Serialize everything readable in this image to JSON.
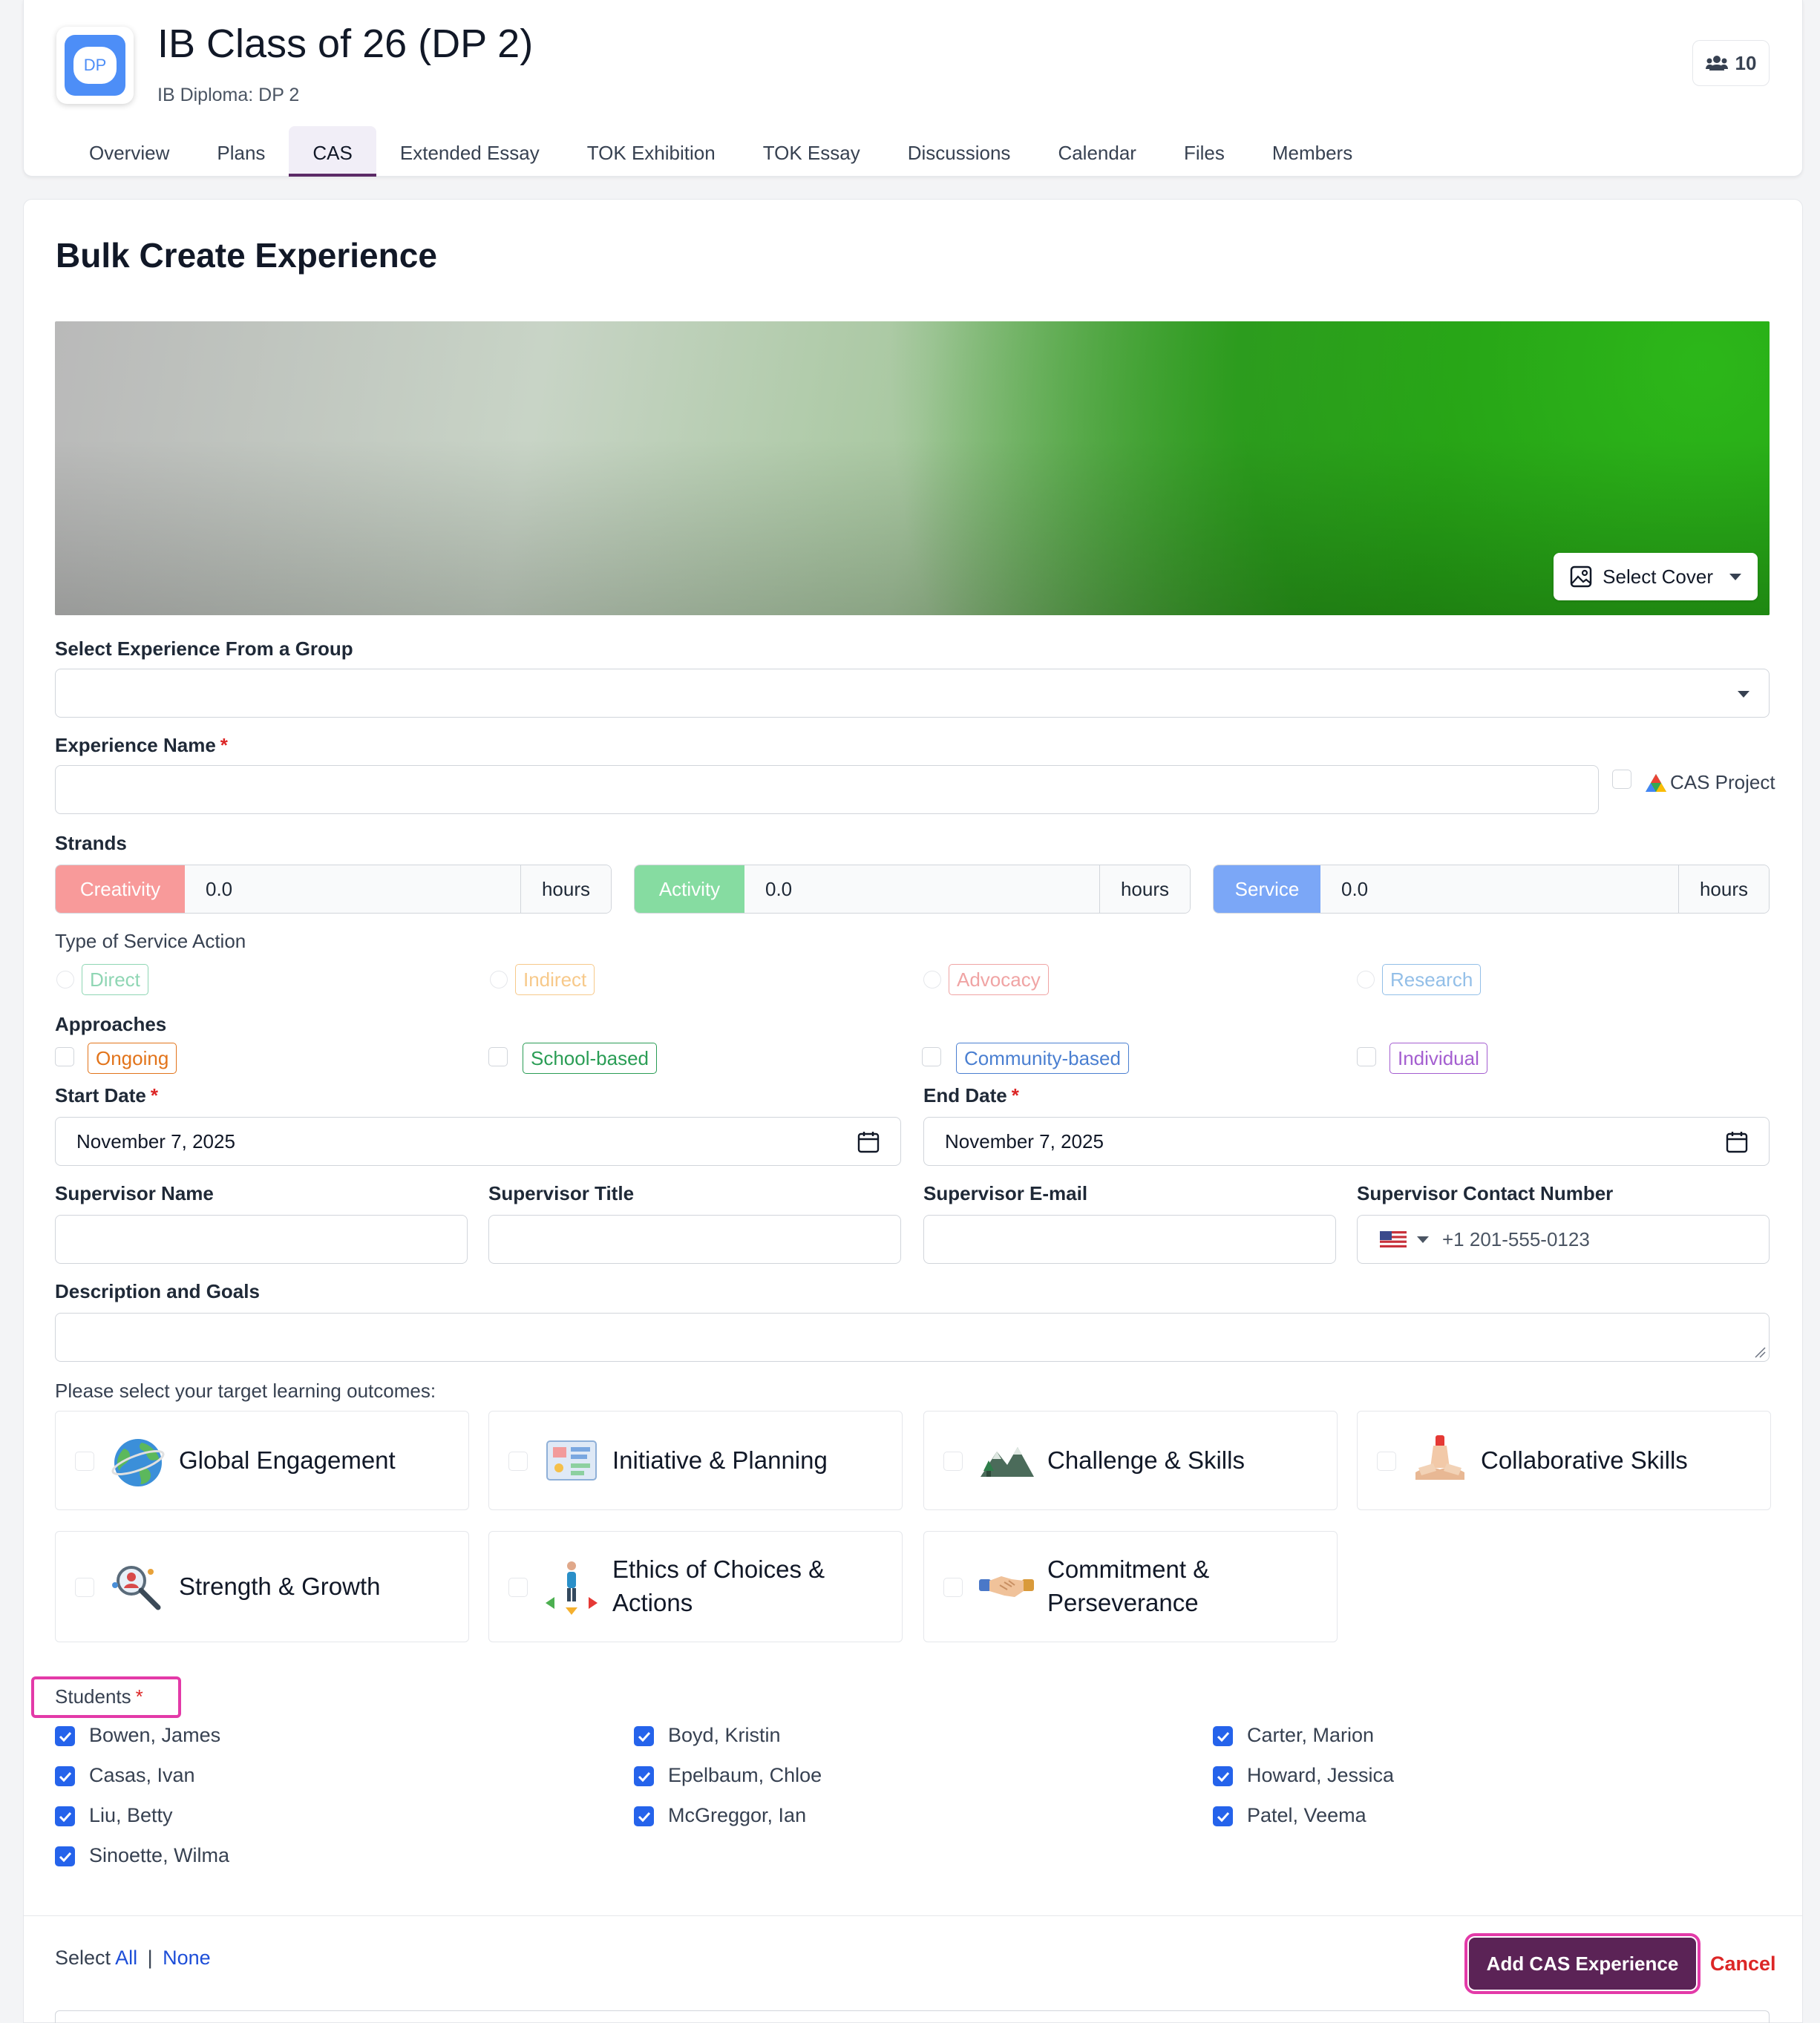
{
  "header": {
    "logo_text": "DP",
    "title": "IB Class of 26 (DP 2)",
    "subtitle": "IB Diploma: DP 2",
    "member_count": "10",
    "tabs": [
      {
        "label": "Overview"
      },
      {
        "label": "Plans"
      },
      {
        "label": "CAS",
        "active": true
      },
      {
        "label": "Extended Essay"
      },
      {
        "label": "TOK Exhibition"
      },
      {
        "label": "TOK Essay"
      },
      {
        "label": "Discussions"
      },
      {
        "label": "Calendar"
      },
      {
        "label": "Files"
      },
      {
        "label": "Members"
      }
    ]
  },
  "form": {
    "heading": "Bulk Create Experience",
    "select_cover_label": "Select Cover",
    "group_label": "Select Experience From a Group",
    "group_value": "",
    "name_label": "Experience Name",
    "required_mark": "*",
    "name_value": "",
    "cas_project_label": "CAS Project",
    "strands_label": "Strands",
    "strands": [
      {
        "name": "Creativity",
        "value": "0.0",
        "unit": "hours",
        "color": "#f89a9a"
      },
      {
        "name": "Activity",
        "value": "0.0",
        "unit": "hours",
        "color": "#86dca1"
      },
      {
        "name": "Service",
        "value": "0.0",
        "unit": "hours",
        "color": "#7ba7f7"
      }
    ],
    "service_type_label": "Type of Service Action",
    "service_types": [
      {
        "label": "Direct",
        "color": "#8fd6b4"
      },
      {
        "label": "Indirect",
        "color": "#f7c98a"
      },
      {
        "label": "Advocacy",
        "color": "#f0a4a4"
      },
      {
        "label": "Research",
        "color": "#93bfe8"
      }
    ],
    "approaches_label": "Approaches",
    "approaches": [
      {
        "label": "Ongoing",
        "color": "#e2741b"
      },
      {
        "label": "School-based",
        "color": "#2a9d55"
      },
      {
        "label": "Community-based",
        "color": "#4a7fd1"
      },
      {
        "label": "Individual",
        "color": "#a45ed0"
      }
    ],
    "start_date_label": "Start Date",
    "start_date_value": "November 7, 2025",
    "end_date_label": "End Date",
    "end_date_value": "November 7, 2025",
    "supervisor_name_label": "Supervisor Name",
    "supervisor_title_label": "Supervisor Title",
    "supervisor_email_label": "Supervisor E-mail",
    "supervisor_phone_label": "Supervisor Contact Number",
    "supervisor_phone_placeholder": "+1 201-555-0123",
    "description_label": "Description and Goals",
    "outcomes_label": "Please select your target learning outcomes:",
    "outcomes": [
      {
        "label": "Global Engagement",
        "icon": "globe-icon"
      },
      {
        "label": "Initiative & Planning",
        "icon": "planning-board-icon"
      },
      {
        "label": "Challenge & Skills",
        "icon": "mountain-icon"
      },
      {
        "label": "Collaborative Skills",
        "icon": "stacked-hands-icon"
      },
      {
        "label": "Strength & Growth",
        "icon": "magnifier-person-icon"
      },
      {
        "label": "Ethics of Choices & Actions",
        "icon": "person-crossroads-icon"
      },
      {
        "label": "Commitment & Perseverance",
        "icon": "handshake-icon"
      }
    ],
    "students_label": "Students",
    "students": [
      {
        "name": "Bowen, James",
        "checked": true
      },
      {
        "name": "Boyd, Kristin",
        "checked": true
      },
      {
        "name": "Carter, Marion",
        "checked": true
      },
      {
        "name": "Casas, Ivan",
        "checked": true
      },
      {
        "name": "Epelbaum, Chloe",
        "checked": true
      },
      {
        "name": "Howard, Jessica",
        "checked": true
      },
      {
        "name": "Liu, Betty",
        "checked": true
      },
      {
        "name": "McGreggor, Ian",
        "checked": true
      },
      {
        "name": "Patel, Veema",
        "checked": true
      },
      {
        "name": "Sinoette, Wilma",
        "checked": true
      }
    ]
  },
  "footer": {
    "select_prefix": "Select",
    "select_all": "All",
    "separator": "|",
    "select_none": "None",
    "submit_label": "Add CAS Experience",
    "cancel_label": "Cancel"
  }
}
